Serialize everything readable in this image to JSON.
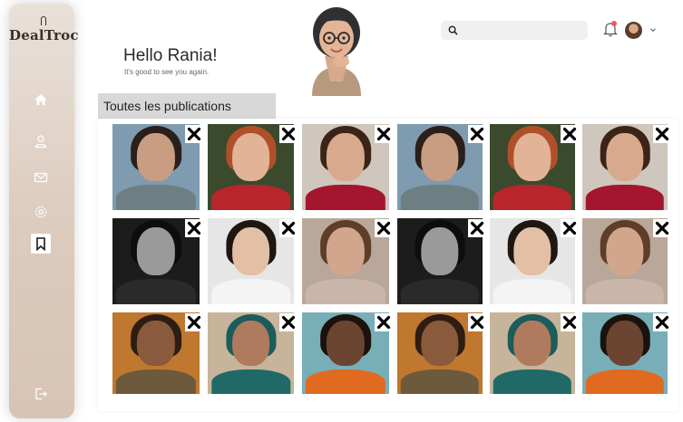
{
  "app": {
    "logo_text": "DealTroc"
  },
  "sidebar": {
    "items": [
      {
        "icon": "home-icon",
        "active": false
      },
      {
        "icon": "user-icon",
        "active": false
      },
      {
        "icon": "mail-icon",
        "active": false
      },
      {
        "icon": "gear-icon",
        "active": false
      },
      {
        "icon": "bookmark-icon",
        "active": true
      }
    ],
    "logout_icon": "logout-icon"
  },
  "header": {
    "search_placeholder": "",
    "search_value": "",
    "notification_dot_color": "#ef5b5b"
  },
  "greeting": {
    "title": "Hello Rania!",
    "subtitle": "It's good to see you again."
  },
  "section": {
    "title": "Toutes les publications"
  },
  "colors": {
    "sidebar_top": "#e9e0d9",
    "sidebar_bottom": "#d7c4b4",
    "section_header_bg": "#d8d8d8"
  },
  "publications": [
    {
      "row": 0,
      "col": 0,
      "bg": "#7e9bb0",
      "skin": "#c99d82",
      "hair": "#2a1f1a",
      "shirt": "#6e7f84"
    },
    {
      "row": 0,
      "col": 1,
      "bg": "#3b4a2c",
      "skin": "#e2b397",
      "hair": "#b0502a",
      "shirt": "#b8262b"
    },
    {
      "row": 0,
      "col": 2,
      "bg": "#cfc6bd",
      "skin": "#d9a98d",
      "hair": "#3a2418",
      "shirt": "#a3162d"
    },
    {
      "row": 0,
      "col": 3,
      "bg": "#7e9bb0",
      "skin": "#c99d82",
      "hair": "#2a1f1a",
      "shirt": "#6e7f84"
    },
    {
      "row": 0,
      "col": 4,
      "bg": "#3b4a2c",
      "skin": "#e2b397",
      "hair": "#b0502a",
      "shirt": "#b8262b"
    },
    {
      "row": 0,
      "col": 5,
      "bg": "#cfc6bd",
      "skin": "#d9a98d",
      "hair": "#3a2418",
      "shirt": "#a3162d"
    },
    {
      "row": 1,
      "col": 0,
      "bg": "#1c1c1c",
      "skin": "#9a9a9a",
      "hair": "#0d0d0d",
      "shirt": "#2a2a2a"
    },
    {
      "row": 1,
      "col": 1,
      "bg": "#e6e6e6",
      "skin": "#e3bfa5",
      "hair": "#1f1611",
      "shirt": "#f4f4f4"
    },
    {
      "row": 1,
      "col": 2,
      "bg": "#b9a79a",
      "skin": "#d2a68d",
      "hair": "#5e3d29",
      "shirt": "#c9b6a8"
    },
    {
      "row": 1,
      "col": 3,
      "bg": "#1c1c1c",
      "skin": "#9a9a9a",
      "hair": "#0d0d0d",
      "shirt": "#2a2a2a"
    },
    {
      "row": 1,
      "col": 4,
      "bg": "#e6e6e6",
      "skin": "#e3bfa5",
      "hair": "#1f1611",
      "shirt": "#f4f4f4"
    },
    {
      "row": 1,
      "col": 5,
      "bg": "#b9a79a",
      "skin": "#d2a68d",
      "hair": "#5e3d29",
      "shirt": "#c9b6a8"
    },
    {
      "row": 2,
      "col": 0,
      "bg": "#c0772f",
      "skin": "#8a5a3c",
      "hair": "#2e1d12",
      "shirt": "#6d5a3c"
    },
    {
      "row": 2,
      "col": 1,
      "bg": "#c6b49b",
      "skin": "#b07a5e",
      "hair": "#1c5c5a",
      "shirt": "#1f6a66"
    },
    {
      "row": 2,
      "col": 2,
      "bg": "#78aeb8",
      "skin": "#6b4532",
      "hair": "#1a120d",
      "shirt": "#e06a1f"
    },
    {
      "row": 2,
      "col": 3,
      "bg": "#c0772f",
      "skin": "#8a5a3c",
      "hair": "#2e1d12",
      "shirt": "#6d5a3c"
    },
    {
      "row": 2,
      "col": 4,
      "bg": "#c6b49b",
      "skin": "#b07a5e",
      "hair": "#1c5c5a",
      "shirt": "#1f6a66"
    },
    {
      "row": 2,
      "col": 5,
      "bg": "#78aeb8",
      "skin": "#6b4532",
      "hair": "#1a120d",
      "shirt": "#e06a1f"
    }
  ]
}
